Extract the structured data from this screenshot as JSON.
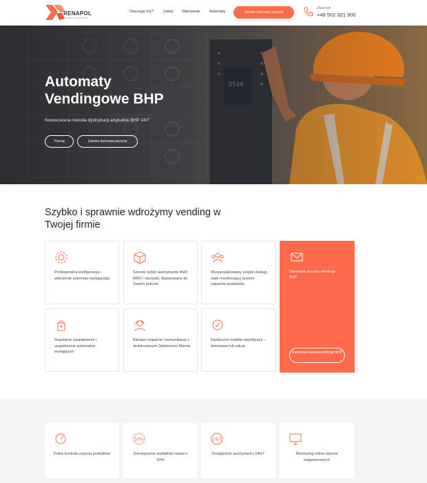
{
  "colors": {
    "accent": "#ff6b4a",
    "panel": "#f4f4f4"
  },
  "header": {
    "logo_text": "RENAPOL",
    "logo_tagline": "SYSTEMY DYSTRYBUCJI",
    "nav": [
      "Dlaczego my?",
      "Zalety",
      "Wdrożenie",
      "Automaty"
    ],
    "cta": "Zamów darmową wycenę",
    "call_label": "Zadzwoń",
    "phone": "+48 502 321 900"
  },
  "hero": {
    "title": "Automaty Vendingowe BHP",
    "subtitle": "Nowoczesna metoda dystrybucji artykułów BHP 24/7",
    "btn_more": "Poznaj",
    "btn_quote": "Zamów darmową wycenę"
  },
  "section2": {
    "title": "Szybko i sprawnie wdrożymy vending w Twojej firmie",
    "cards": [
      {
        "icon": "gear-icon",
        "text": "Profesjonalna konfiguracja i wdrożenie automatu wydającego"
      },
      {
        "icon": "box-icon",
        "text": "Szeroki wybór asortymentu BHP, MRO i narzędzi, dopasowany do Twoich potrzeb"
      },
      {
        "icon": "team-icon",
        "text": "Wyspecjalizowany zespół obsługi, stałe monitorujący poziom zapasów produktów"
      },
      {
        "icon": "refill-icon",
        "text": "Regularne zaopatrzenie i uzupełnienie automatów wydających"
      },
      {
        "icon": "support-icon",
        "text": "Bieżące wsparcie i komunikacja z dedykowanym Opiekunem Klienta"
      },
      {
        "icon": "model-icon",
        "text": "Elastyczne modele współpracy – dzierżawa lub zakup"
      }
    ],
    "orange": {
      "icon": "mail-icon",
      "text": "Darmowa wycena vendingu BHP",
      "button": "Darmowa wycena vendingu BHP"
    }
  },
  "section3": {
    "cards": [
      {
        "icon": "control-icon",
        "text": "Pełna kontrola zużycia produktów"
      },
      {
        "icon": "percent-icon",
        "text": "Zmniejszenie wydatków nawet o 50%"
      },
      {
        "icon": "clock-24-icon",
        "text": "Dostępność asortymentu 24h/7"
      },
      {
        "icon": "monitor-icon",
        "text": "Monitoring online stanów magazynowych"
      }
    ]
  }
}
